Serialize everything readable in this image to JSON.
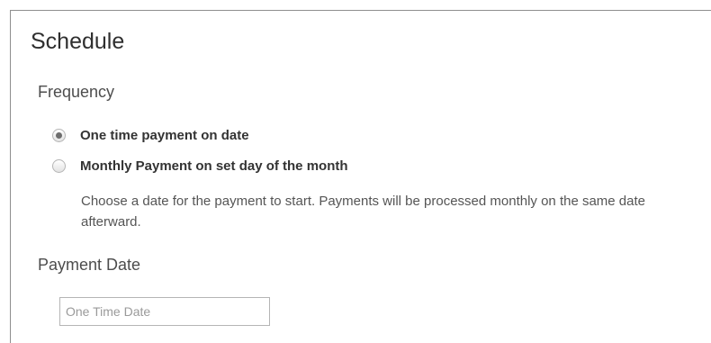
{
  "schedule": {
    "title": "Schedule",
    "frequency_label": "Frequency",
    "options": [
      {
        "label": "One time payment on date",
        "checked": true
      },
      {
        "label": "Monthly Payment on set day of the month",
        "checked": false
      }
    ],
    "help_text": "Choose a date for the payment to start. Payments will be processed monthly on the same date afterward.",
    "payment_date_label": "Payment Date",
    "payment_date_placeholder": "One Time Date",
    "payment_date_value": ""
  }
}
